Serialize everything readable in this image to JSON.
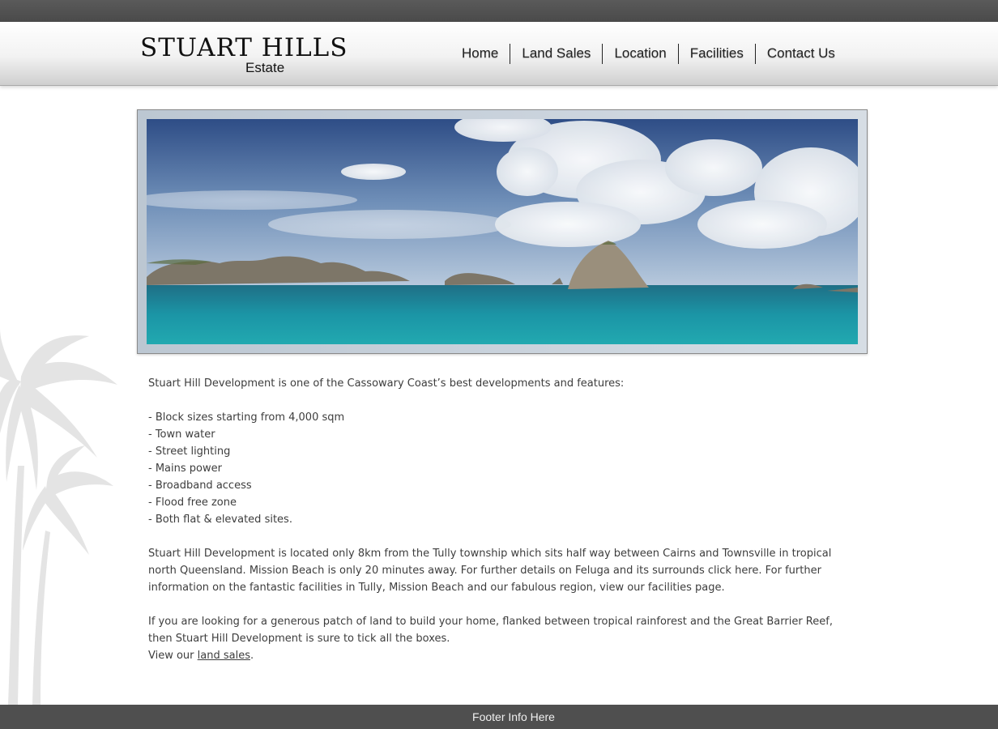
{
  "site": {
    "logo_main": "STUART HILLS",
    "logo_sub": "Estate"
  },
  "nav": {
    "items": [
      "Home",
      "Land Sales",
      "Location",
      "Facilities",
      "Contact Us"
    ]
  },
  "intro": "Stuart Hill Development  is one of the Cassowary Coast’s best developments and features:",
  "features": [
    "- Block sizes starting from 4,000 sqm",
    "- Town water",
    "- Street lighting",
    "- Mains power",
    "- Broadband access",
    "- Flood free zone",
    "- Both flat & elevated sites."
  ],
  "location_paragraph": "Stuart Hill Development is located only 8km from the Tully township which sits half way between Cairns and Townsville in tropical north Queensland.  Mission Beach is only 20 minutes away. For further details on Feluga and its surrounds click here.  For further information on the fantastic facilities in Tully, Mission Beach and our fabulous region, view our facilities page.",
  "closing_paragraph": "If you are looking for a generous patch of land to build your home, flanked between tropical rainforest and the Great Barrier Reef, then Stuart Hill Development is sure to tick all the boxes.",
  "view_prefix": "View our ",
  "view_link": "land sales",
  "view_suffix": ".",
  "footer": "Footer Info Here",
  "colors": {
    "topbar": "#4f4f4f",
    "footer": "#4f4f4f",
    "text": "#3d3d3d"
  }
}
